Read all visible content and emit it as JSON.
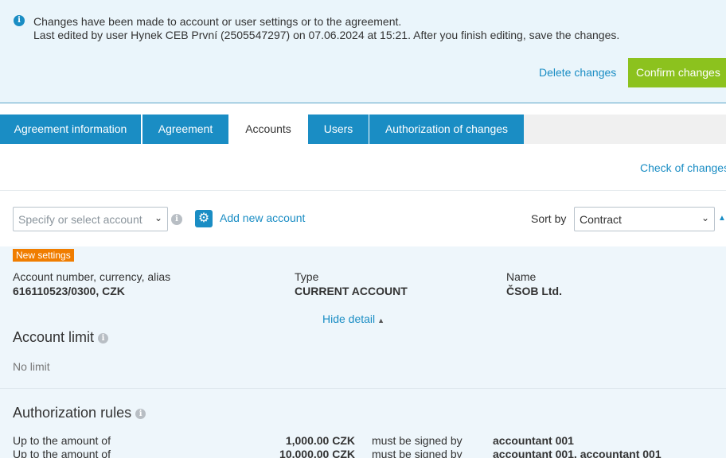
{
  "notice": {
    "icon": "info-icon",
    "line1": "Changes have been made to account or user settings or to the agreement.",
    "line2": "Last edited by user Hynek CEB První (2505547297) on 07.06.2024 at 15:21. After you finish editing, save the changes.",
    "delete_label": "Delete changes",
    "confirm_label": "Confirm changes"
  },
  "tabs": [
    {
      "label": "Agreement information",
      "active": false
    },
    {
      "label": "Agreement",
      "active": false
    },
    {
      "label": "Accounts",
      "active": true
    },
    {
      "label": "Users",
      "active": false
    },
    {
      "label": "Authorization of changes",
      "active": false
    }
  ],
  "check_changes_label": "Check of changes",
  "filter": {
    "account_placeholder": "Specify or select account",
    "add_account_label": "Add new account",
    "sort_label": "Sort by",
    "sort_value": "Contract"
  },
  "account": {
    "badge": "New settings",
    "number_label": "Account number, currency, alias",
    "number_value": "616110523/0300, CZK",
    "type_label": "Type",
    "type_value": "CURRENT ACCOUNT",
    "name_label": "Name",
    "name_value": "ČSOB Ltd.",
    "hide_detail_label": "Hide detail"
  },
  "account_limit": {
    "title": "Account limit",
    "value": "No limit"
  },
  "authorization_rules": {
    "title": "Authorization rules",
    "rows": [
      {
        "prefix": "Up to the amount of",
        "amount": "1,000.00 CZK",
        "verb": "must be signed by",
        "signers": "accountant 001"
      },
      {
        "prefix": "Up to the amount of",
        "amount": "10,000.00 CZK",
        "verb": "must be signed by",
        "signers": "accountant 001, accountant 001"
      }
    ]
  },
  "colors": {
    "accent": "#1a8dc4",
    "confirm": "#8cc21e",
    "badge": "#f07d00",
    "notice_bg": "#eaf5fb"
  }
}
